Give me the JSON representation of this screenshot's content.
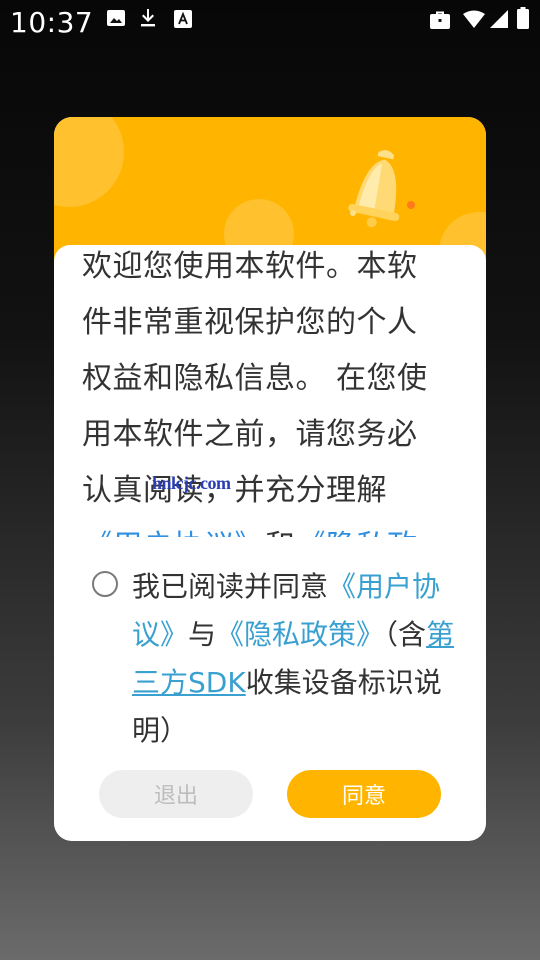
{
  "status_bar": {
    "time": "10:37",
    "icons": [
      "image-icon",
      "download-icon",
      "a-icon",
      "briefcase-icon",
      "wifi-icon",
      "signal-icon",
      "battery-icon"
    ]
  },
  "dialog": {
    "header_color": "#ffb400",
    "body_segments": {
      "intro": "欢迎您使用本软件。本软件非常重视保护您的个人权益和隐私信息。 在您使用本软件之前，请您务必认真阅读，并充分理解",
      "user_agreement": "《用户协议》",
      "and": "和",
      "privacy_policy": "《隐私政"
    },
    "watermark": "hnlcjc.com",
    "agreement": {
      "prefix": "我已阅读并同意",
      "user_agreement": "《用户协议》",
      "and": "与",
      "privacy_policy": "《隐私政策》",
      "paren_open": "（含",
      "sdk_link": "第三方SDK",
      "suffix": "收集设备标识说明）"
    },
    "buttons": {
      "exit": "退出",
      "agree": "同意"
    },
    "accent_color": "#ffb400",
    "link_color": "#3aa0d0"
  }
}
